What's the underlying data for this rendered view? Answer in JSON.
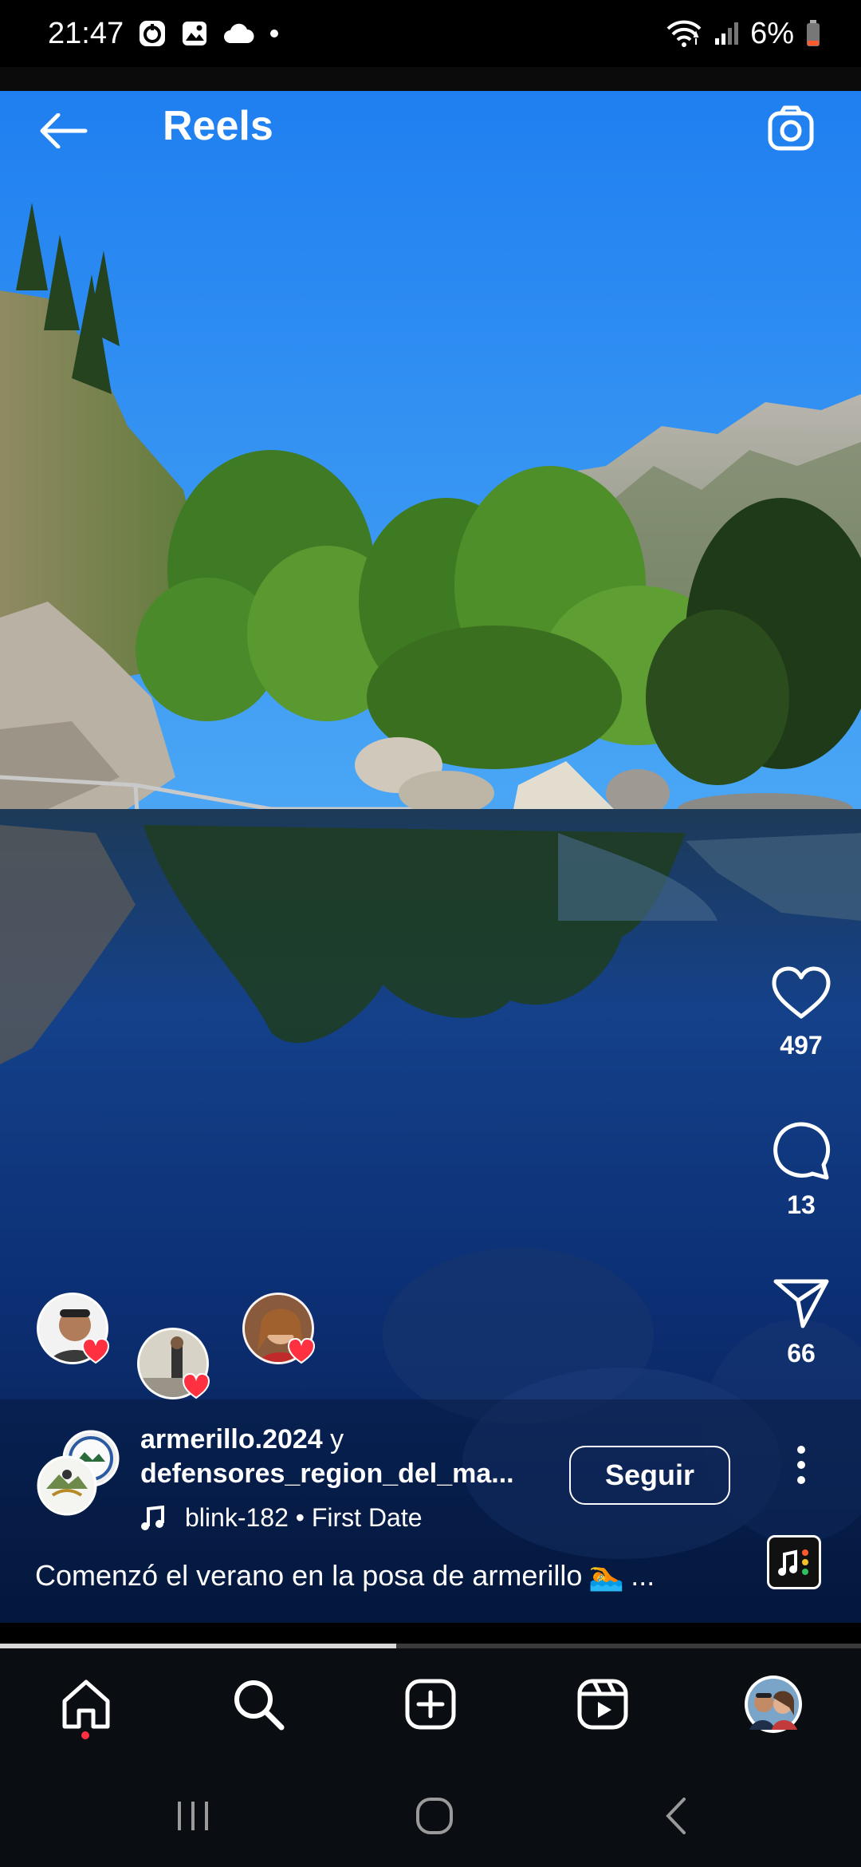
{
  "status_bar": {
    "time": "21:47",
    "battery": "6%",
    "icons": [
      "notification-icon",
      "gallery-icon",
      "cloud-icon",
      "dot-icon",
      "wifi-icon",
      "signal-icon",
      "battery-icon"
    ]
  },
  "header": {
    "title": "Reels",
    "back_icon": "arrow-left-icon",
    "camera_icon": "camera-icon"
  },
  "actions": {
    "likes": "497",
    "comments": "13",
    "shares": "66"
  },
  "author": {
    "username": "armerillo.2024",
    "connector": "y",
    "collaborator": "defensores_region_del_ma...",
    "follow_label": "Seguir"
  },
  "music": {
    "artist_track": "blink-182 • First Date"
  },
  "caption": {
    "text": "Comenzó el verano en la posa de armerillo",
    "emoji": "🏊",
    "more": "..."
  },
  "progress": {
    "fraction": 0.46
  },
  "bottom_nav": [
    "home-icon",
    "search-icon",
    "create-icon",
    "reels-icon",
    "profile-avatar"
  ],
  "system_nav": [
    "recents-icon",
    "home-circle-icon",
    "back-chevron-icon"
  ],
  "colors": {
    "sky": "#1f7ff0",
    "water": "#0a2b6b",
    "heart_badge": "#ff3040",
    "nav_bg": "#0a0d12"
  }
}
